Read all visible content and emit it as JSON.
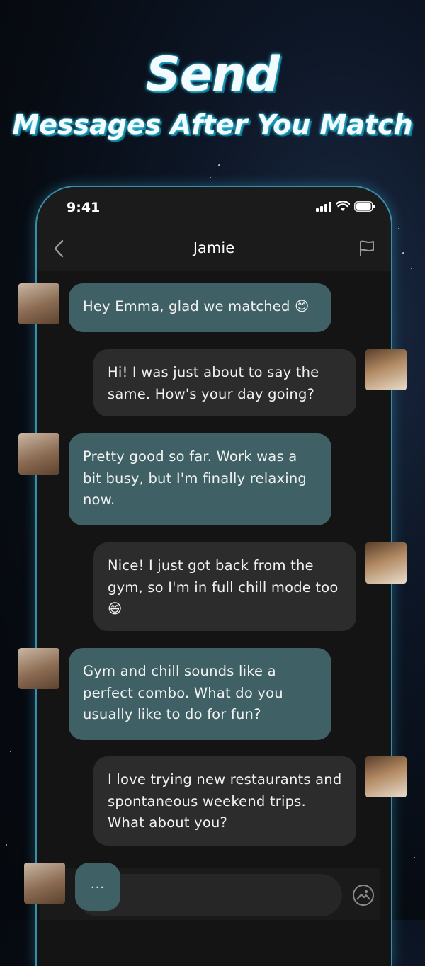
{
  "headline": {
    "title": "Send",
    "subtitle": "Messages After You Match"
  },
  "status_bar": {
    "time": "9:41"
  },
  "chat": {
    "contact_name": "Jamie"
  },
  "messages": [
    {
      "from": "Jamie",
      "text": "Hey Emma, glad we matched 😊"
    },
    {
      "from": "Emma",
      "text": "Hi! I was just about to say the same. How's your day going?"
    },
    {
      "from": "Jamie",
      "text": "Pretty good so far. Work was a bit busy, but I'm finally relaxing now."
    },
    {
      "from": "Emma",
      "text": "Nice! I just got back from the gym, so I'm in full chill mode too 😄"
    },
    {
      "from": "Jamie",
      "text": "Gym and chill sounds like a perfect combo. What do you usually like to do for fun?"
    },
    {
      "from": "Emma",
      "text": "I love trying new restaurants and spontaneous weekend trips. What about you?"
    }
  ],
  "typing_indicator": "...",
  "icons": {
    "back": "chevron-left-icon",
    "report": "flag-icon",
    "attach": "image-icon"
  },
  "colors": {
    "received_bubble": "#3f6166",
    "sent_bubble": "#2c2c2c",
    "accent_glow": "#38c7e6"
  }
}
